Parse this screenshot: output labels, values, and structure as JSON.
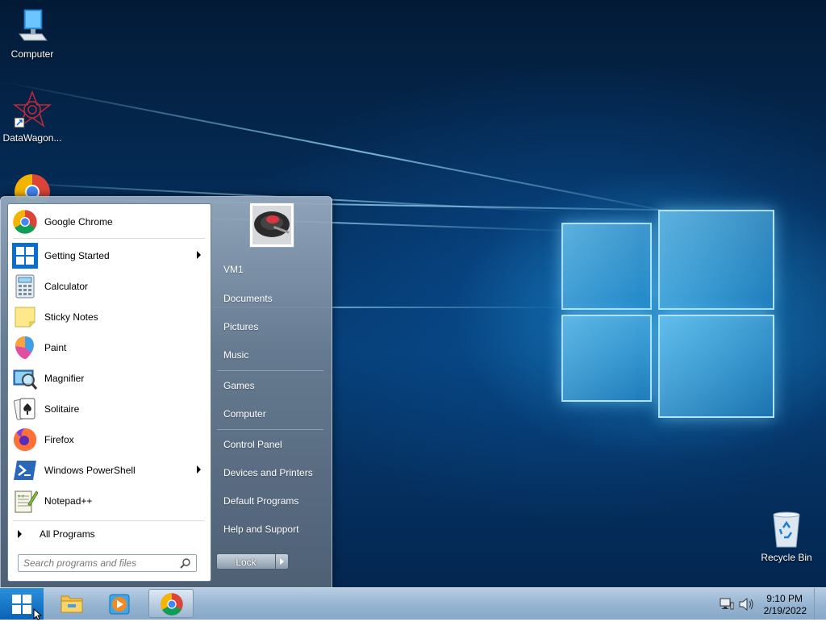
{
  "desktop": {
    "icons": [
      {
        "label": "Computer"
      },
      {
        "label": "DataWagon..."
      },
      {
        "label": "Recycle Bin"
      }
    ]
  },
  "start_menu": {
    "programs": [
      {
        "label": "Google Chrome",
        "icon": "chrome-icon",
        "submenu": false
      },
      {
        "label": "Getting Started",
        "icon": "windows-icon",
        "submenu": true
      },
      {
        "label": "Calculator",
        "icon": "calculator-icon",
        "submenu": false
      },
      {
        "label": "Sticky Notes",
        "icon": "sticky-notes-icon",
        "submenu": false
      },
      {
        "label": "Paint",
        "icon": "paint-icon",
        "submenu": false
      },
      {
        "label": "Magnifier",
        "icon": "magnifier-icon",
        "submenu": false
      },
      {
        "label": "Solitaire",
        "icon": "solitaire-icon",
        "submenu": false
      },
      {
        "label": "Firefox",
        "icon": "firefox-icon",
        "submenu": false
      },
      {
        "label": "Windows PowerShell",
        "icon": "powershell-icon",
        "submenu": true
      },
      {
        "label": "Notepad++",
        "icon": "notepadpp-icon",
        "submenu": false
      }
    ],
    "all_programs": "All Programs",
    "search_placeholder": "Search programs and files",
    "places": [
      {
        "label": "VM1"
      },
      {
        "label": "Documents"
      },
      {
        "label": "Pictures"
      },
      {
        "label": "Music"
      },
      {
        "label": "Games"
      },
      {
        "label": "Computer"
      },
      {
        "label": "Control Panel"
      },
      {
        "label": "Devices and Printers"
      },
      {
        "label": "Default Programs"
      },
      {
        "label": "Help and Support"
      }
    ],
    "lock_label": "Lock"
  },
  "taskbar": {
    "pinned": [
      {
        "icon": "file-explorer-icon"
      },
      {
        "icon": "media-player-icon"
      },
      {
        "icon": "chrome-icon",
        "active": true
      }
    ],
    "clock": {
      "time": "9:10 PM",
      "date": "2/19/2022"
    }
  },
  "colors": {
    "start_button": "#0a63b6",
    "taskbar": "#98b6d3",
    "wallpaper_glow": "#28aae6"
  }
}
